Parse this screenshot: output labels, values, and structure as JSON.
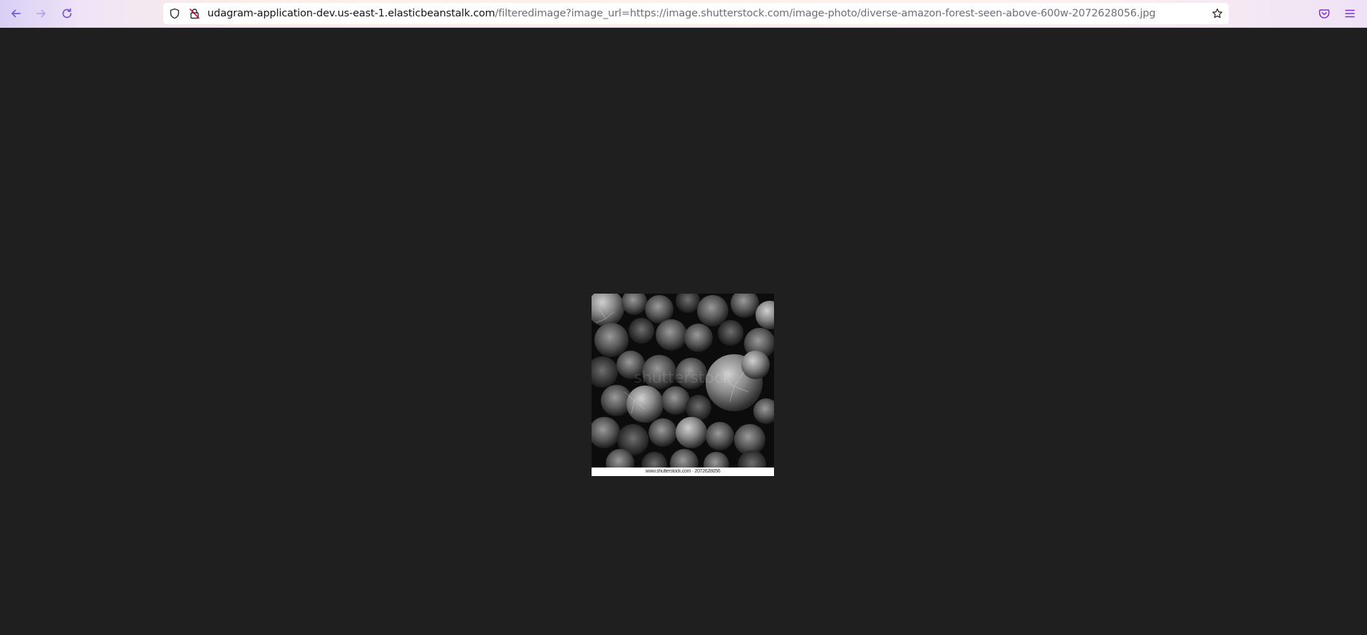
{
  "browser": {
    "url_host": "udagram-application-dev.us-east-1.elasticbeanstalk.com",
    "url_path": "/filteredimage?image_url=https://image.shutterstock.com/image-photo/diverse-amazon-forest-seen-above-600w-2072628056.jpg",
    "icons": {
      "back": "back-arrow-icon",
      "forward": "forward-arrow-icon",
      "reload": "reload-icon",
      "tracking": "shield-icon",
      "permissions": "lock-slash-icon",
      "bookmark": "star-icon",
      "pocket": "pocket-icon",
      "menu": "hamburger-menu-icon"
    }
  },
  "image": {
    "caption": "www.shutterstock.com · 2072628056",
    "watermark": "shutterstock"
  },
  "colors": {
    "page_background": "#1f1f1f",
    "accent": "#8f4ae0"
  }
}
